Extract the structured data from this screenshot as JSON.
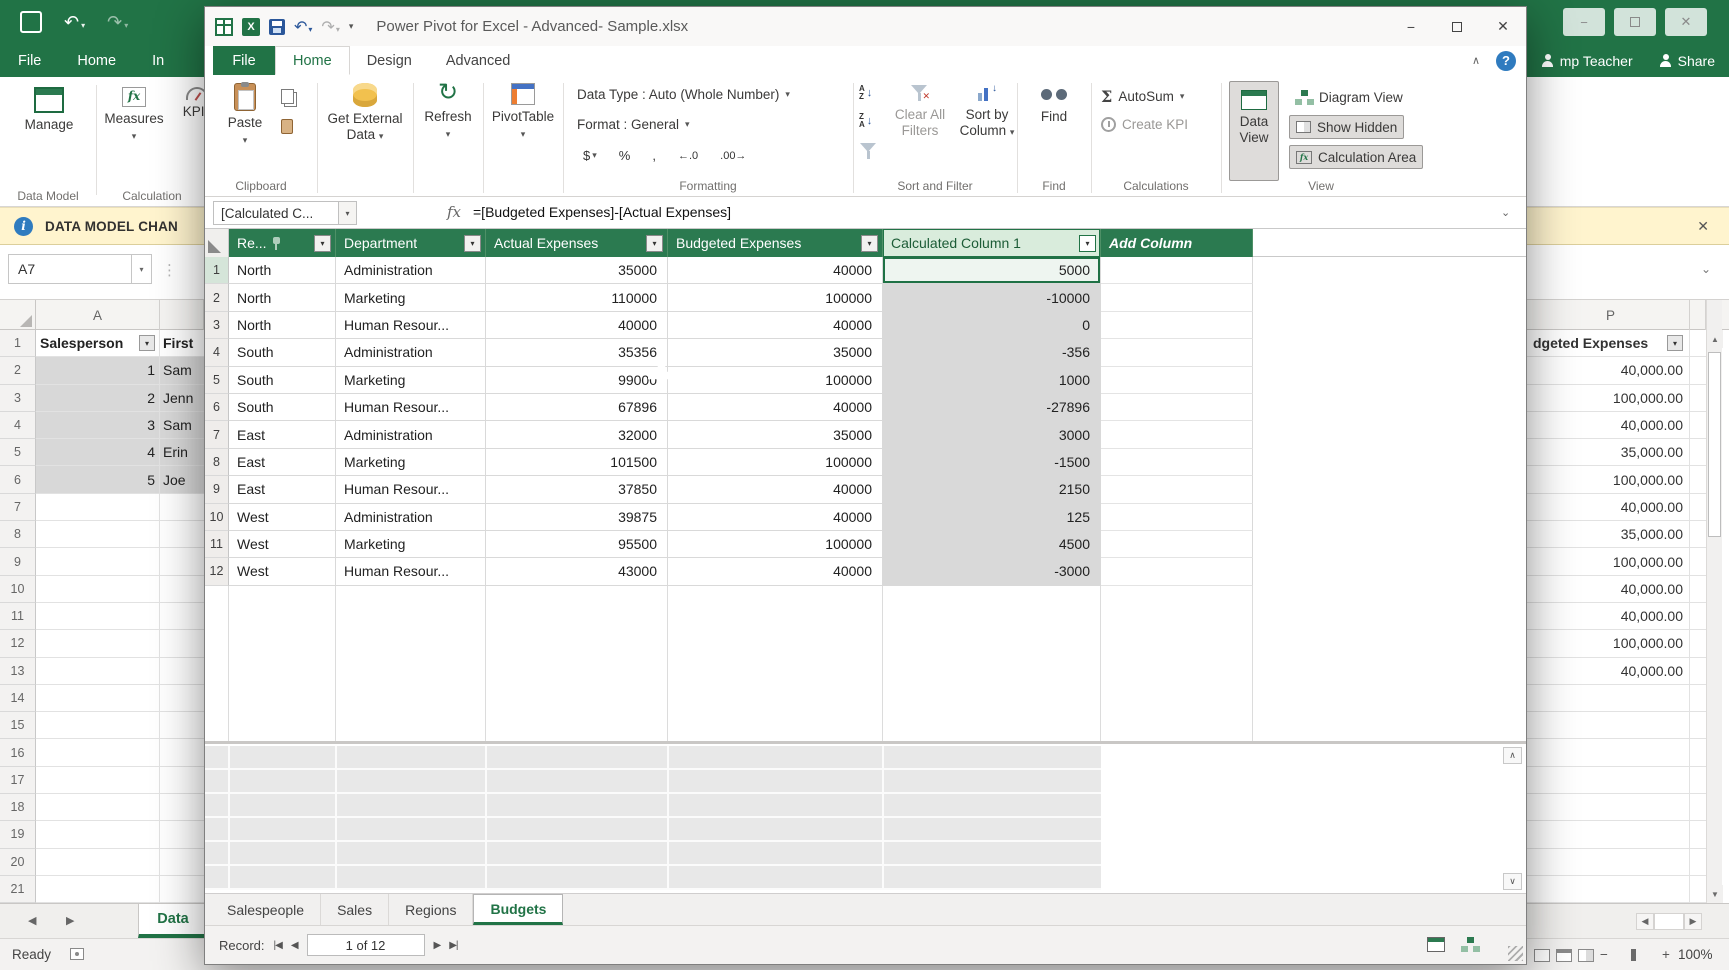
{
  "colors": {
    "excel_green": "#217346",
    "pp_grid_header_green": "#2b7a50",
    "selected_column_header_bg": "#d9ecdc",
    "selected_column_cell_bg": "#d9d9d9",
    "active_cell_border": "#1f7145",
    "message_bar_bg": "#fff4ce"
  },
  "icons": {
    "dropdown": "▾",
    "undo": "↶",
    "redo": "↷",
    "minimize": "−",
    "close": "✕",
    "help": "?",
    "info": "i",
    "expand": "⌄",
    "collapse": "∧",
    "chev_up": "∧",
    "chev_down": "∨",
    "up": "▲",
    "down": "▼",
    "left": "◀",
    "right": "▶",
    "first": "|◀",
    "last": "▶|",
    "sigma": "Σ",
    "dollar": "$",
    "percent": "%",
    "comma": ",",
    "inc_decimal": "←.0",
    "dec_decimal": ".00→",
    "fx": "fx",
    "excel_x": "X",
    "sort_a": "A",
    "sort_z": "Z",
    "small_down": "↓",
    "refresh": "↻",
    "dots": "⋮",
    "minus": "−",
    "plus": "+"
  },
  "excel": {
    "tabs": [
      "File",
      "Home",
      "In"
    ],
    "account": "mp Teacher",
    "share": "Share",
    "ribbon": {
      "manage": "Manage",
      "data_model": "Data Model",
      "measures": "Measures",
      "kpis": "KPIs",
      "calculation": "Calculation"
    },
    "message_bar": "DATA MODEL CHAN",
    "name_box": "A7",
    "col_a": "A",
    "col_p": "P",
    "rows": [
      "1",
      "2",
      "3",
      "4",
      "5",
      "6",
      "7",
      "8",
      "9",
      "10",
      "11",
      "12",
      "13",
      "14",
      "15",
      "16",
      "17",
      "18",
      "19",
      "20",
      "21"
    ],
    "table": {
      "header_a": "Salesperson",
      "header_b": "First",
      "data": [
        {
          "id": "1",
          "name": "Sam"
        },
        {
          "id": "2",
          "name": "Jenn"
        },
        {
          "id": "3",
          "name": "Sam"
        },
        {
          "id": "4",
          "name": "Erin"
        },
        {
          "id": "5",
          "name": "Joe"
        }
      ]
    },
    "p_column": {
      "header": "dgeted Expenses",
      "values": [
        "40,000.00",
        "100,000.00",
        "40,000.00",
        "35,000.00",
        "100,000.00",
        "40,000.00",
        "35,000.00",
        "100,000.00",
        "40,000.00",
        "40,000.00",
        "100,000.00",
        "40,000.00"
      ]
    },
    "sheet_tab": "Data",
    "status": "Ready",
    "zoom": "100%"
  },
  "pp": {
    "title": "Power Pivot for Excel - Advanced- Sample.xlsx",
    "tabs": [
      "File",
      "Home",
      "Design",
      "Advanced"
    ],
    "ribbon": {
      "paste": "Paste",
      "clipboard": "Clipboard",
      "get_external_data": "Get External Data",
      "refresh": "Refresh",
      "pivottable": "PivotTable",
      "data_type": "Data Type : Auto (Whole Number)",
      "format": "Format : General",
      "formatting": "Formatting",
      "clear_all_filters": "Clear All Filters",
      "sort_by_column": "Sort by Column",
      "sort_and_filter": "Sort and Filter",
      "find": "Find",
      "autosum": "AutoSum",
      "create_kpi": "Create KPI",
      "calculations": "Calculations",
      "data_view": "Data View",
      "diagram_view": "Diagram View",
      "show_hidden": "Show Hidden",
      "calculation_area": "Calculation Area",
      "view": "View"
    },
    "formula": {
      "name_box": "[Calculated C...",
      "text": "=[Budgeted Expenses]-[Actual Expenses]"
    },
    "grid": {
      "col_region": "Re...",
      "col_department": "Department",
      "col_actual": "Actual Expenses",
      "col_budgeted": "Budgeted Expenses",
      "col_calculated": "Calculated Column 1",
      "col_add": "Add Column",
      "rows": [
        {
          "n": "1",
          "region": "North",
          "department": "Administration",
          "actual": "35000",
          "budgeted": "40000",
          "calc": "5000"
        },
        {
          "n": "2",
          "region": "North",
          "department": "Marketing",
          "actual": "110000",
          "budgeted": "100000",
          "calc": "-10000"
        },
        {
          "n": "3",
          "region": "North",
          "department": "Human Resour...",
          "actual": "40000",
          "budgeted": "40000",
          "calc": "0"
        },
        {
          "n": "4",
          "region": "South",
          "department": "Administration",
          "actual": "35356",
          "budgeted": "35000",
          "calc": "-356"
        },
        {
          "n": "5",
          "region": "South",
          "department": "Marketing",
          "actual": "99000",
          "budgeted": "100000",
          "calc": "1000"
        },
        {
          "n": "6",
          "region": "South",
          "department": "Human Resour...",
          "actual": "67896",
          "budgeted": "40000",
          "calc": "-27896"
        },
        {
          "n": "7",
          "region": "East",
          "department": "Administration",
          "actual": "32000",
          "budgeted": "35000",
          "calc": "3000"
        },
        {
          "n": "8",
          "region": "East",
          "department": "Marketing",
          "actual": "101500",
          "budgeted": "100000",
          "calc": "-1500"
        },
        {
          "n": "9",
          "region": "East",
          "department": "Human Resour...",
          "actual": "37850",
          "budgeted": "40000",
          "calc": "2150"
        },
        {
          "n": "10",
          "region": "West",
          "department": "Administration",
          "actual": "39875",
          "budgeted": "40000",
          "calc": "125"
        },
        {
          "n": "11",
          "region": "West",
          "department": "Marketing",
          "actual": "95500",
          "budgeted": "100000",
          "calc": "4500"
        },
        {
          "n": "12",
          "region": "West",
          "department": "Human Resour...",
          "actual": "43000",
          "budgeted": "40000",
          "calc": "-3000"
        }
      ]
    },
    "sheet_tabs": [
      "Salespeople",
      "Sales",
      "Regions",
      "Budgets"
    ],
    "record": {
      "label": "Record:",
      "value": "1 of 12"
    }
  }
}
